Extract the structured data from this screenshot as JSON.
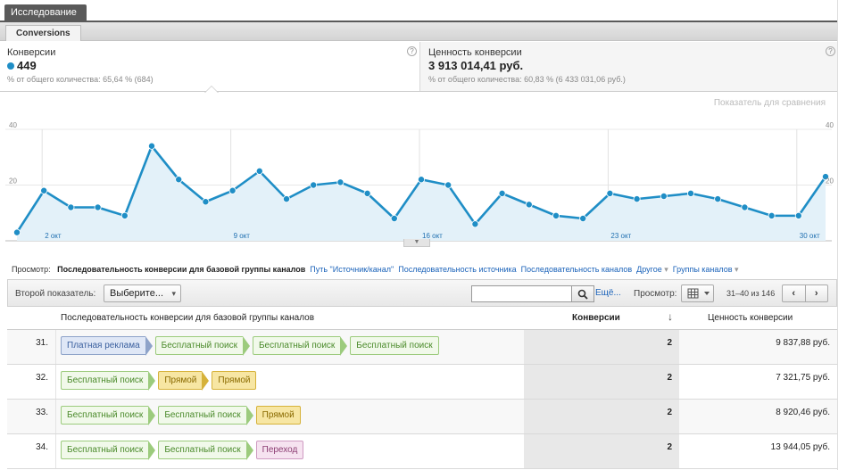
{
  "top_tab": "Исследование",
  "sub_tab": "Conversions",
  "metric1": {
    "label": "Конверсии",
    "value": "449",
    "sub": "% от общего количества: 65,64 % (684)"
  },
  "metric2": {
    "label": "Ценность конверсии",
    "value": "3 913 014,41 руб.",
    "sub": "% от общего количества: 60,83 % (6 433 031,06 руб.)"
  },
  "help_icon": "?",
  "compare_label": "Показатель для сравнения",
  "colors": {
    "line": "#1f8ec6",
    "fill": "#e3f1f9"
  },
  "chart_data": {
    "type": "area",
    "y_ticks": [
      "40",
      "20"
    ],
    "ylim": [
      0,
      40
    ],
    "x_tick_labels": [
      "2 окт",
      "9 окт",
      "16 окт",
      "23 окт",
      "30 окт"
    ],
    "values": [
      3,
      18,
      12,
      12,
      9,
      34,
      22,
      14,
      18,
      25,
      15,
      20,
      21,
      17,
      8,
      22,
      20,
      6,
      17,
      13,
      9,
      8,
      17,
      15,
      16,
      17,
      15,
      12,
      9,
      9,
      23
    ]
  },
  "view": {
    "label": "Просмотр:",
    "options": [
      {
        "text": "Последовательность конверсии для базовой группы каналов",
        "selected": true,
        "dropdown": false
      },
      {
        "text": "Путь \"Источник/канал\"",
        "selected": false,
        "dropdown": false
      },
      {
        "text": "Последовательность источника",
        "selected": false,
        "dropdown": false
      },
      {
        "text": "Последовательность каналов",
        "selected": false,
        "dropdown": false
      },
      {
        "text": "Другое",
        "selected": false,
        "dropdown": true
      },
      {
        "text": "Группы каналов",
        "selected": false,
        "dropdown": true
      }
    ]
  },
  "toolbar": {
    "secondary_label": "Второй показатель:",
    "secondary_select": "Выберите...",
    "search_placeholder": "",
    "more_link": "Ещё...",
    "view_label": "Просмотр:",
    "range": "31–40 из 146",
    "prev": "‹",
    "next": "›"
  },
  "table": {
    "headers": {
      "sequence": "Последовательность конверсии для базовой группы каналов",
      "conversions": "Конверсии",
      "sort_icon": "↓",
      "value": "Ценность конверсии"
    },
    "rows": [
      {
        "index": "31.",
        "path": [
          {
            "label": "Платная реклама",
            "type": "paid"
          },
          {
            "label": "Бесплатный поиск",
            "type": "organic"
          },
          {
            "label": "Бесплатный поиск",
            "type": "organic"
          },
          {
            "label": "Бесплатный поиск",
            "type": "organic"
          }
        ],
        "conversions": "2",
        "value": "9 837,88 руб."
      },
      {
        "index": "32.",
        "path": [
          {
            "label": "Бесплатный поиск",
            "type": "organic"
          },
          {
            "label": "Прямой",
            "type": "direct"
          },
          {
            "label": "Прямой",
            "type": "direct"
          }
        ],
        "conversions": "2",
        "value": "7 321,75 руб."
      },
      {
        "index": "33.",
        "path": [
          {
            "label": "Бесплатный поиск",
            "type": "organic"
          },
          {
            "label": "Бесплатный поиск",
            "type": "organic"
          },
          {
            "label": "Прямой",
            "type": "direct"
          }
        ],
        "conversions": "2",
        "value": "8 920,46 руб."
      },
      {
        "index": "34.",
        "path": [
          {
            "label": "Бесплатный поиск",
            "type": "organic"
          },
          {
            "label": "Бесплатный поиск",
            "type": "organic"
          },
          {
            "label": "Переход",
            "type": "referral"
          }
        ],
        "conversions": "2",
        "value": "13 944,05 руб."
      }
    ]
  }
}
